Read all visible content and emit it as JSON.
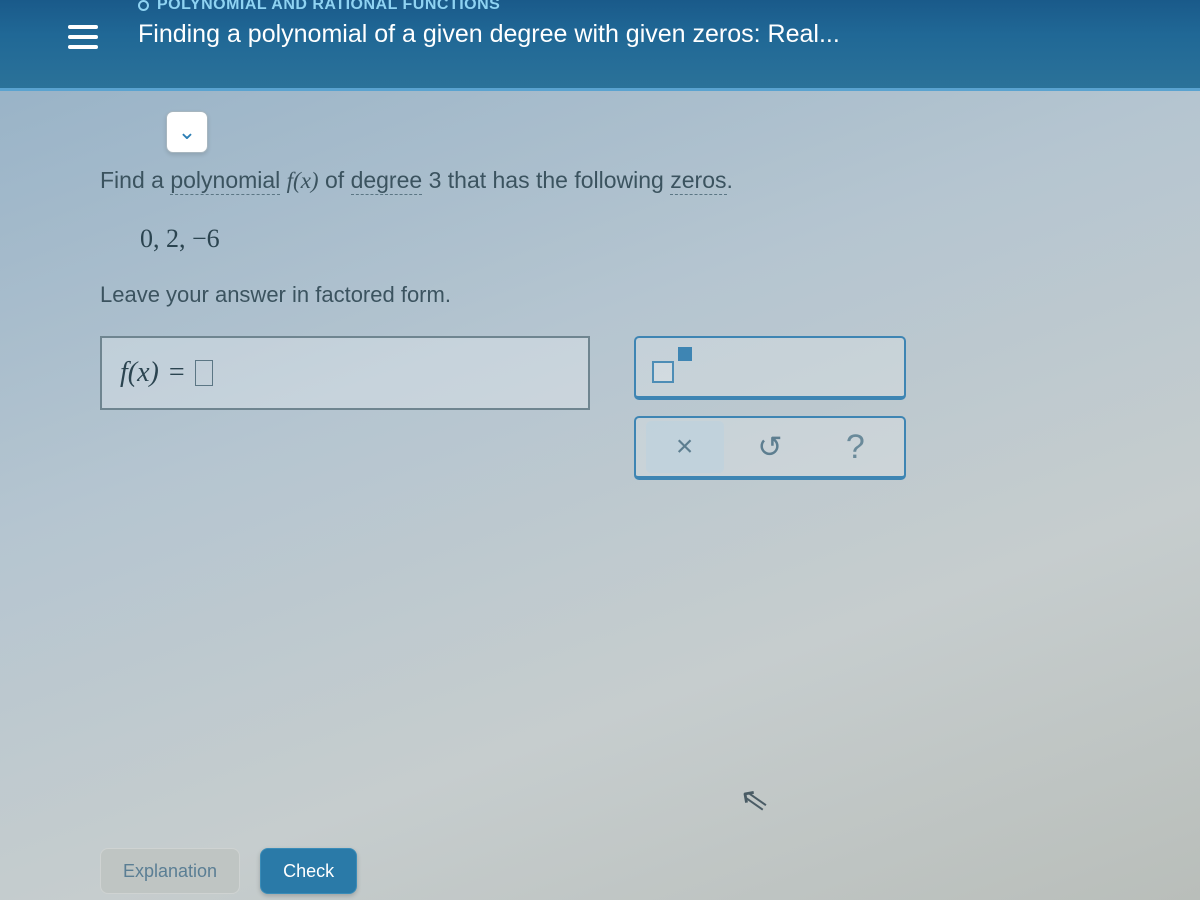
{
  "header": {
    "category": "POLYNOMIAL AND RATIONAL FUNCTIONS",
    "title": "Finding a polynomial of a given degree with given zeros: Real..."
  },
  "question": {
    "lead": "Find a ",
    "term_polynomial": "polynomial",
    "fx": "f(x)",
    "mid1": " of ",
    "term_degree": "degree",
    "mid2": " 3 that has the following ",
    "term_zeros": "zeros",
    "tail": ".",
    "zeros_list": "0, 2, −6",
    "factored_hint": "Leave your answer in factored form."
  },
  "answer_box": {
    "lhs": "f(x)",
    "eq": "="
  },
  "palette": {
    "exponent_tool": "exponent",
    "clear": "×",
    "reset": "↺",
    "help": "?"
  },
  "footer": {
    "explanation": "Explanation",
    "check": "Check"
  }
}
